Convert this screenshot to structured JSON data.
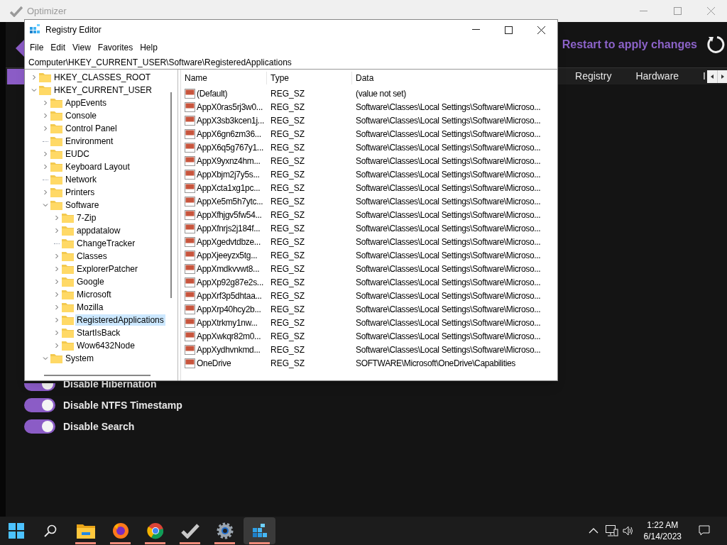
{
  "optimizer": {
    "title": "Optimizer",
    "restart_text": "Restart to apply changes",
    "tabs": [
      {
        "label": "Registry",
        "selected": false
      },
      {
        "label": "Hardware",
        "selected": false
      },
      {
        "label": "I",
        "selected": false
      }
    ],
    "toggles": [
      {
        "label": "Disable Hibernation",
        "on": true
      },
      {
        "label": "Disable NTFS Timestamp",
        "on": true
      },
      {
        "label": "Disable Search",
        "on": true
      }
    ]
  },
  "regedit": {
    "title": "Registry Editor",
    "menu": [
      "File",
      "Edit",
      "View",
      "Favorites",
      "Help"
    ],
    "address": "Computer\\HKEY_CURRENT_USER\\Software\\RegisteredApplications",
    "tree": [
      {
        "label": "HKEY_CLASSES_ROOT",
        "expandable": true,
        "expanded": false,
        "selected": false
      },
      {
        "label": "HKEY_CURRENT_USER",
        "expandable": true,
        "expanded": true,
        "selected": false,
        "children": [
          {
            "label": "AppEvents",
            "expandable": true,
            "expanded": false,
            "selected": false
          },
          {
            "label": "Console",
            "expandable": true,
            "expanded": false,
            "selected": false
          },
          {
            "label": "Control Panel",
            "expandable": true,
            "expanded": false,
            "selected": false
          },
          {
            "label": "Environment",
            "expandable": false,
            "expanded": false,
            "selected": false
          },
          {
            "label": "EUDC",
            "expandable": true,
            "expanded": false,
            "selected": false
          },
          {
            "label": "Keyboard Layout",
            "expandable": true,
            "expanded": false,
            "selected": false
          },
          {
            "label": "Network",
            "expandable": false,
            "expanded": false,
            "selected": false
          },
          {
            "label": "Printers",
            "expandable": true,
            "expanded": false,
            "selected": false
          },
          {
            "label": "Software",
            "expandable": true,
            "expanded": true,
            "selected": false,
            "children": [
              {
                "label": "7-Zip",
                "expandable": true,
                "expanded": false,
                "selected": false
              },
              {
                "label": "appdatalow",
                "expandable": true,
                "expanded": false,
                "selected": false
              },
              {
                "label": "ChangeTracker",
                "expandable": false,
                "expanded": false,
                "selected": false
              },
              {
                "label": "Classes",
                "expandable": true,
                "expanded": false,
                "selected": false
              },
              {
                "label": "ExplorerPatcher",
                "expandable": true,
                "expanded": false,
                "selected": false
              },
              {
                "label": "Google",
                "expandable": true,
                "expanded": false,
                "selected": false
              },
              {
                "label": "Microsoft",
                "expandable": true,
                "expanded": false,
                "selected": false
              },
              {
                "label": "Mozilla",
                "expandable": true,
                "expanded": false,
                "selected": false
              },
              {
                "label": "RegisteredApplications",
                "expandable": true,
                "expanded": false,
                "selected": true
              },
              {
                "label": "StartIsBack",
                "expandable": true,
                "expanded": false,
                "selected": false
              },
              {
                "label": "Wow6432Node",
                "expandable": true,
                "expanded": false,
                "selected": false
              }
            ]
          },
          {
            "label": "System",
            "expandable": true,
            "expanded": true,
            "selected": false
          }
        ]
      }
    ],
    "columns": [
      "Name",
      "Type",
      "Data"
    ],
    "rows": [
      {
        "name": "(Default)",
        "type": "REG_SZ",
        "data": "(value not set)"
      },
      {
        "name": "AppX0ras5rj3w0...",
        "type": "REG_SZ",
        "data": "Software\\Classes\\Local Settings\\Software\\Microso..."
      },
      {
        "name": "AppX3sb3kcen1j...",
        "type": "REG_SZ",
        "data": "Software\\Classes\\Local Settings\\Software\\Microso..."
      },
      {
        "name": "AppX6gn6zm36...",
        "type": "REG_SZ",
        "data": "Software\\Classes\\Local Settings\\Software\\Microso..."
      },
      {
        "name": "AppX6q5g767y1...",
        "type": "REG_SZ",
        "data": "Software\\Classes\\Local Settings\\Software\\Microso..."
      },
      {
        "name": "AppX9yxnz4hm...",
        "type": "REG_SZ",
        "data": "Software\\Classes\\Local Settings\\Software\\Microso..."
      },
      {
        "name": "AppXbjm2j7y5s...",
        "type": "REG_SZ",
        "data": "Software\\Classes\\Local Settings\\Software\\Microso..."
      },
      {
        "name": "AppXcta1xg1pc...",
        "type": "REG_SZ",
        "data": "Software\\Classes\\Local Settings\\Software\\Microso..."
      },
      {
        "name": "AppXe5m5h7ytc...",
        "type": "REG_SZ",
        "data": "Software\\Classes\\Local Settings\\Software\\Microso..."
      },
      {
        "name": "AppXfhjgv5fw54...",
        "type": "REG_SZ",
        "data": "Software\\Classes\\Local Settings\\Software\\Microso..."
      },
      {
        "name": "AppXfnrjs2j184f...",
        "type": "REG_SZ",
        "data": "Software\\Classes\\Local Settings\\Software\\Microso..."
      },
      {
        "name": "AppXgedvtdbze...",
        "type": "REG_SZ",
        "data": "Software\\Classes\\Local Settings\\Software\\Microso..."
      },
      {
        "name": "AppXjeeyzx5tg...",
        "type": "REG_SZ",
        "data": "Software\\Classes\\Local Settings\\Software\\Microso..."
      },
      {
        "name": "AppXmdkvvwt8...",
        "type": "REG_SZ",
        "data": "Software\\Classes\\Local Settings\\Software\\Microso..."
      },
      {
        "name": "AppXp92g87e2s...",
        "type": "REG_SZ",
        "data": "Software\\Classes\\Local Settings\\Software\\Microso..."
      },
      {
        "name": "AppXrf3p5dhtaa...",
        "type": "REG_SZ",
        "data": "Software\\Classes\\Local Settings\\Software\\Microso..."
      },
      {
        "name": "AppXrp40hcy2b...",
        "type": "REG_SZ",
        "data": "Software\\Classes\\Local Settings\\Software\\Microso..."
      },
      {
        "name": "AppXtrkmy1nw...",
        "type": "REG_SZ",
        "data": "Software\\Classes\\Local Settings\\Software\\Microso..."
      },
      {
        "name": "AppXwkqr82m0...",
        "type": "REG_SZ",
        "data": "Software\\Classes\\Local Settings\\Software\\Microso..."
      },
      {
        "name": "AppXydhvnkmd...",
        "type": "REG_SZ",
        "data": "Software\\Classes\\Local Settings\\Software\\Microso..."
      },
      {
        "name": "OneDrive",
        "type": "REG_SZ",
        "data": "SOFTWARE\\Microsoft\\OneDrive\\Capabilities"
      }
    ]
  },
  "taskbar": {
    "apps": [
      {
        "kind": "explorer",
        "running": true,
        "selected": false
      },
      {
        "kind": "firefox",
        "running": true,
        "selected": false
      },
      {
        "kind": "chrome",
        "running": true,
        "selected": false
      },
      {
        "kind": "check",
        "running": true,
        "selected": false
      },
      {
        "kind": "settings",
        "running": true,
        "selected": false
      },
      {
        "kind": "regedit",
        "running": true,
        "selected": true
      }
    ],
    "time": "1:22 AM",
    "date": "6/14/2023"
  }
}
